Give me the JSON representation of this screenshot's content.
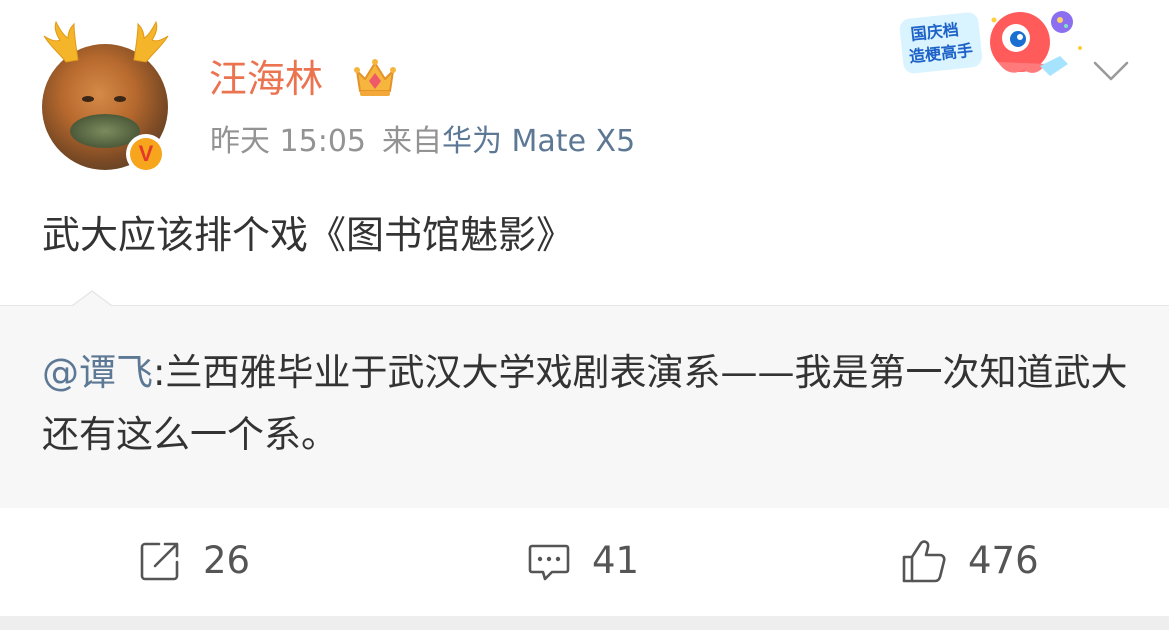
{
  "author": {
    "name": "汪海林",
    "verified_badge": "V",
    "time": "昨天 15:05",
    "source_prefix": "来自",
    "device": "华为 Mate X5",
    "icons": [
      "antler-headband-icon",
      "crown-icon",
      "verified-icon"
    ]
  },
  "sticker": {
    "line1": "国庆档",
    "line2": "造梗高手"
  },
  "post": {
    "text": "武大应该排个戏《图书馆魅影》"
  },
  "repost": {
    "mention": "@谭飞",
    "text": ":兰西雅毕业于武汉大学戏剧表演系——我是第一次知道武大还有这么一个系。"
  },
  "actions": {
    "share_count": "26",
    "comment_count": "41",
    "like_count": "476"
  },
  "colors": {
    "username": "#eb7350",
    "link": "#5d7895",
    "meta": "#939393",
    "body_text": "#333333",
    "repost_bg": "#f7f7f7"
  }
}
